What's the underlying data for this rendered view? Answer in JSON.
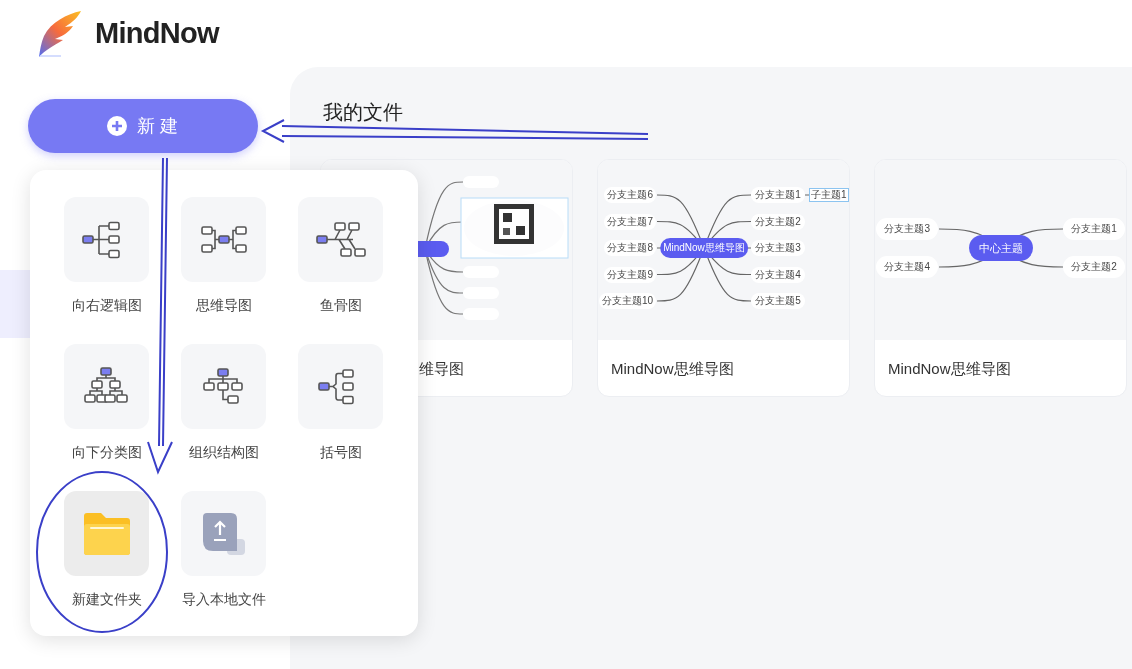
{
  "logo": {
    "text": "MindNow"
  },
  "new_button": {
    "label": "新 建"
  },
  "main": {
    "title": "我的文件",
    "files": [
      {
        "title": "维导图"
      },
      {
        "title": "MindNow思维导图",
        "thumbnail": {
          "kind": "map",
          "center": "MindNow思维导图",
          "left": [
            "分支主题6",
            "分支主题7",
            "分支主题8",
            "分支主题9",
            "分支主题10"
          ],
          "right": [
            {
              "text": "分支主题1",
              "child": "子主题1"
            },
            {
              "text": "分支主题2"
            },
            {
              "text": "分支主题3"
            },
            {
              "text": "分支主题4"
            },
            {
              "text": "分支主题5"
            }
          ]
        }
      },
      {
        "title": "MindNow思维导图",
        "thumbnail": {
          "kind": "map",
          "center": "中心主题",
          "left": [
            "分支主题3",
            "分支主题4"
          ],
          "right": [
            {
              "text": "分支主题1"
            },
            {
              "text": "分支主题2"
            }
          ]
        }
      }
    ]
  },
  "menu": {
    "items": [
      {
        "label": "向右逻辑图",
        "kind": "logic_right",
        "selected": false
      },
      {
        "label": "思维导图",
        "kind": "mind_map",
        "selected": false
      },
      {
        "label": "鱼骨图",
        "kind": "fishbone",
        "selected": false
      },
      {
        "label": "向下分类图",
        "kind": "org_down",
        "selected": false
      },
      {
        "label": "组织结构图",
        "kind": "org_chart",
        "selected": false
      },
      {
        "label": "括号图",
        "kind": "bracket",
        "selected": false
      },
      {
        "label": "新建文件夹",
        "kind": "folder",
        "selected": true
      },
      {
        "label": "导入本地文件",
        "kind": "import",
        "selected": false
      }
    ]
  }
}
